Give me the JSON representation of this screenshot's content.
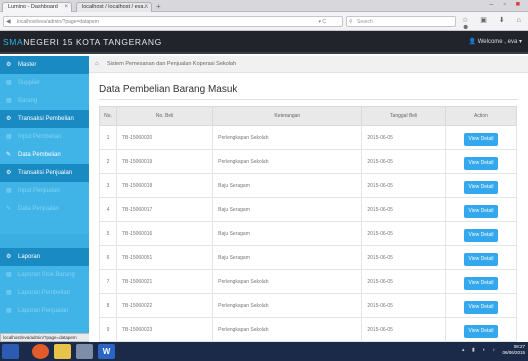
{
  "browser": {
    "tabs": [
      {
        "label": "Lumino - Dashboard"
      },
      {
        "label": "localhost / localhost / eva..."
      }
    ],
    "address": "localhost/eva/admin/?page=datapem",
    "search_placeholder": "Search"
  },
  "app": {
    "brand_prefix": "SMA",
    "brand_rest": "NEGERI 15 KOTA TANGERANG",
    "welcome": "Welcome , eva"
  },
  "sidebar": {
    "items": [
      {
        "label": "Master",
        "type": "header",
        "icon": "gear-icon"
      },
      {
        "label": "Supplier",
        "type": "sub",
        "icon": "grid-icon"
      },
      {
        "label": "Barang",
        "type": "sub",
        "icon": "grid-icon"
      },
      {
        "label": "Transaksi Pembelian",
        "type": "header",
        "icon": "gear-icon"
      },
      {
        "label": "Input Pembelian",
        "type": "sub",
        "icon": "grid-icon"
      },
      {
        "label": "Data Pembelian",
        "type": "sub on",
        "icon": "pencil-icon"
      },
      {
        "label": "Transaksi Penjualan",
        "type": "header",
        "icon": "gear-icon"
      },
      {
        "label": "Input Penjualan",
        "type": "sub",
        "icon": "grid-icon"
      },
      {
        "label": "Data Penjualan",
        "type": "sub",
        "icon": "pencil-icon"
      },
      {
        "label": "Laporan",
        "type": "header",
        "icon": "gear-icon"
      },
      {
        "label": "Laporan Stok Barang",
        "type": "sub",
        "icon": "grid-icon"
      },
      {
        "label": "Laporan Pembelian",
        "type": "sub",
        "icon": "grid-icon"
      },
      {
        "label": "Laporan Penjualan",
        "type": "sub",
        "icon": "grid-icon"
      }
    ]
  },
  "status_url": "localhost/eva/admin/?page=datapem",
  "main": {
    "breadcrumb": "Sistem Pemesanan dan Penjualan Koperasi Sekolah",
    "title": "Data Pembelian Barang Masuk",
    "columns": [
      "No.",
      "No. Beli",
      "Keterangan",
      "Tanggal Beli",
      "Action"
    ],
    "rows": [
      {
        "no": "1",
        "no_beli": "TB-15060020",
        "keterangan": "Perlengkapan Sekolah",
        "tanggal": "2015-06-05",
        "action": "View Detail"
      },
      {
        "no": "2",
        "no_beli": "TB-15060019",
        "keterangan": "Perlengkapan Sekolah",
        "tanggal": "2015-06-05",
        "action": "View Detail"
      },
      {
        "no": "3",
        "no_beli": "TB-15060018",
        "keterangan": "Baju Seragam",
        "tanggal": "2015-06-05",
        "action": "View Detail"
      },
      {
        "no": "4",
        "no_beli": "TB-15060017",
        "keterangan": "Baju Seragam",
        "tanggal": "2015-06-05",
        "action": "View Detail"
      },
      {
        "no": "5",
        "no_beli": "TB-15060016",
        "keterangan": "Baju Seragam",
        "tanggal": "2015-06-05",
        "action": "View Detail"
      },
      {
        "no": "6",
        "no_beli": "TB-15060051",
        "keterangan": "Baju Seragam",
        "tanggal": "2015-06-05",
        "action": "View Detail"
      },
      {
        "no": "7",
        "no_beli": "TB-15060021",
        "keterangan": "Perlengkapan Sekolah",
        "tanggal": "2015-06-05",
        "action": "View Detail"
      },
      {
        "no": "8",
        "no_beli": "TB-15060022",
        "keterangan": "Perlengkapan Sekolah",
        "tanggal": "2015-06-05",
        "action": "View Detail"
      },
      {
        "no": "9",
        "no_beli": "TB-15060023",
        "keterangan": "Perlengkapan Sekolah",
        "tanggal": "2015-06-05",
        "action": "View Detail"
      }
    ]
  },
  "taskbar": {
    "time": "08:27",
    "date": "06/06/2015"
  },
  "colors": {
    "sidebar": "#41b4e7",
    "sidebar_header": "#1a8ac2",
    "button": "#33a8ec",
    "appbar": "#21252b"
  }
}
